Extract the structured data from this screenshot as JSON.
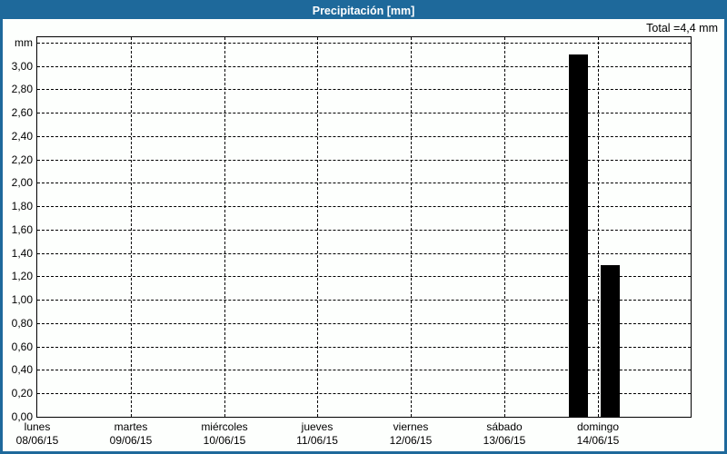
{
  "title_bar": {
    "text": "Precipitación [mm]",
    "background": "#1E699B",
    "text_color": "#FFFFFF"
  },
  "chart_data": {
    "type": "bar",
    "title": "Precipitación [mm]",
    "total_text": "Total =4,4 mm",
    "total_value_mm": 4.4,
    "unit": "mm",
    "ylim": [
      0,
      3.2
    ],
    "ytick_step": 0.2,
    "grid": {
      "style": "dashed",
      "color": "#000000"
    },
    "bar_color": "#000000",
    "yticks": [
      {
        "v": 0.0,
        "label": "0,00"
      },
      {
        "v": 0.2,
        "label": "0,20"
      },
      {
        "v": 0.4,
        "label": "0,40"
      },
      {
        "v": 0.6,
        "label": "0,60"
      },
      {
        "v": 0.8,
        "label": "0,80"
      },
      {
        "v": 1.0,
        "label": "1,00"
      },
      {
        "v": 1.2,
        "label": "1,20"
      },
      {
        "v": 1.4,
        "label": "1,40"
      },
      {
        "v": 1.6,
        "label": "1,60"
      },
      {
        "v": 1.8,
        "label": "1,80"
      },
      {
        "v": 2.0,
        "label": "2,00"
      },
      {
        "v": 2.2,
        "label": "2,20"
      },
      {
        "v": 2.4,
        "label": "2,40"
      },
      {
        "v": 2.6,
        "label": "2,60"
      },
      {
        "v": 2.8,
        "label": "2,80"
      },
      {
        "v": 3.0,
        "label": "3,00"
      },
      {
        "v": 3.2,
        "label": "mm"
      }
    ],
    "x_categories": [
      {
        "day": "lunes",
        "date": "08/06/15"
      },
      {
        "day": "martes",
        "date": "09/06/15"
      },
      {
        "day": "miércoles",
        "date": "10/06/15"
      },
      {
        "day": "jueves",
        "date": "11/06/15"
      },
      {
        "day": "viernes",
        "date": "12/06/15"
      },
      {
        "day": "sábado",
        "date": "13/06/15"
      },
      {
        "day": "domingo",
        "date": "14/06/15"
      }
    ],
    "bars": [
      {
        "x_days_from_start": 5.79,
        "value": 3.1
      },
      {
        "x_days_from_start": 6.13,
        "value": 1.3
      }
    ]
  }
}
